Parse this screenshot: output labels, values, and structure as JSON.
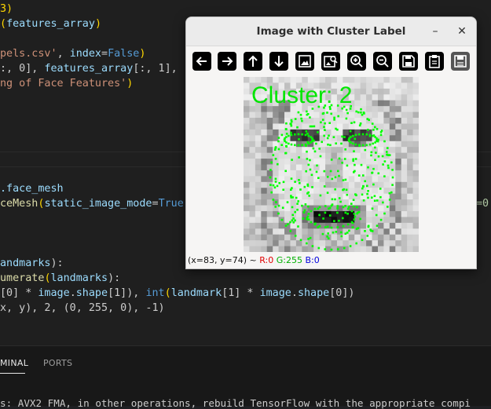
{
  "editor": {
    "lines": [
      [
        {
          "t": "3)",
          "c": "br"
        }
      ],
      [
        {
          "t": "(",
          "c": "br"
        },
        {
          "t": "features_array",
          "c": "var"
        },
        {
          "t": ")",
          "c": "br"
        }
      ],
      [],
      [
        {
          "t": "pels.csv'",
          "c": "str"
        },
        {
          "t": ", ",
          "c": "pl"
        },
        {
          "t": "index",
          "c": "var"
        },
        {
          "t": "=",
          "c": "pl"
        },
        {
          "t": "False",
          "c": "kw"
        },
        {
          "t": ")",
          "c": "br"
        }
      ],
      [
        {
          "t": ":, 0], ",
          "c": "pl"
        },
        {
          "t": "features_array",
          "c": "var"
        },
        {
          "t": "[:, 1],",
          "c": "pl"
        }
      ],
      [
        {
          "t": "ng of Face Features'",
          "c": "str"
        },
        {
          "t": ")",
          "c": "br"
        }
      ],
      [],
      [],
      [],
      [
        {
          "t": ".face_mesh",
          "c": "var"
        }
      ],
      [
        {
          "t": "ceMesh",
          "c": "fn"
        },
        {
          "t": "(",
          "c": "br"
        },
        {
          "t": "static_image_mode",
          "c": "var"
        },
        {
          "t": "=",
          "c": "pl"
        },
        {
          "t": "True",
          "c": "kw"
        }
      ],
      [],
      [],
      [
        {
          "t": "andmarks",
          "c": "var"
        },
        {
          "t": "):",
          "c": "pl"
        }
      ],
      [
        {
          "t": "umerate",
          "c": "fn"
        },
        {
          "t": "(",
          "c": "br"
        },
        {
          "t": "landmarks",
          "c": "var"
        },
        {
          "t": "):",
          "c": "pl"
        }
      ],
      [
        {
          "t": "[0] * ",
          "c": "pl"
        },
        {
          "t": "image",
          "c": "var"
        },
        {
          "t": ".",
          "c": "pl"
        },
        {
          "t": "shape",
          "c": "var"
        },
        {
          "t": "[1]), ",
          "c": "pl"
        },
        {
          "t": "int",
          "c": "kw"
        },
        {
          "t": "(",
          "c": "br"
        },
        {
          "t": "landmark",
          "c": "var"
        },
        {
          "t": "[1] * ",
          "c": "pl"
        },
        {
          "t": "image",
          "c": "var"
        },
        {
          "t": ".",
          "c": "pl"
        },
        {
          "t": "shape",
          "c": "var"
        },
        {
          "t": "[0])",
          "c": "pl"
        }
      ],
      [
        {
          "t": "x, y), 2, (0, 255, 0), -1)",
          "c": "pl"
        }
      ]
    ],
    "right_fragment": "=0."
  },
  "panel": {
    "tabs": [
      "MINAL",
      "PORTS"
    ],
    "terminal_line": "s: AVX2 FMA, in other operations, rebuild TensorFlow with the appropriate compi"
  },
  "window": {
    "title": "Image with Cluster Label",
    "minimize_label": "–",
    "close_label": "✕",
    "toolbar": [
      {
        "icon": "arrow-left-icon",
        "tip": "Back"
      },
      {
        "icon": "arrow-right-icon",
        "tip": "Forward"
      },
      {
        "icon": "arrow-up-icon",
        "tip": "Pan up"
      },
      {
        "icon": "arrow-down-icon",
        "tip": "Pan down"
      },
      {
        "icon": "image-icon",
        "tip": "Zoom to fit"
      },
      {
        "icon": "image-search-icon",
        "tip": "Zoom original"
      },
      {
        "icon": "zoom-in-icon",
        "tip": "Zoom in"
      },
      {
        "icon": "zoom-out-icon",
        "tip": "Zoom out"
      },
      {
        "icon": "save-icon",
        "tip": "Save"
      },
      {
        "icon": "clipboard-icon",
        "tip": "Copy"
      },
      {
        "icon": "properties-icon",
        "tip": "Properties"
      }
    ],
    "image_label": "Cluster: 2",
    "label_color": "#00e600",
    "dot_color": "#00ff00",
    "status": {
      "coords": "(x=83, y=74) ~",
      "r": "R:0",
      "g": "G:255",
      "b": "B:0"
    }
  }
}
